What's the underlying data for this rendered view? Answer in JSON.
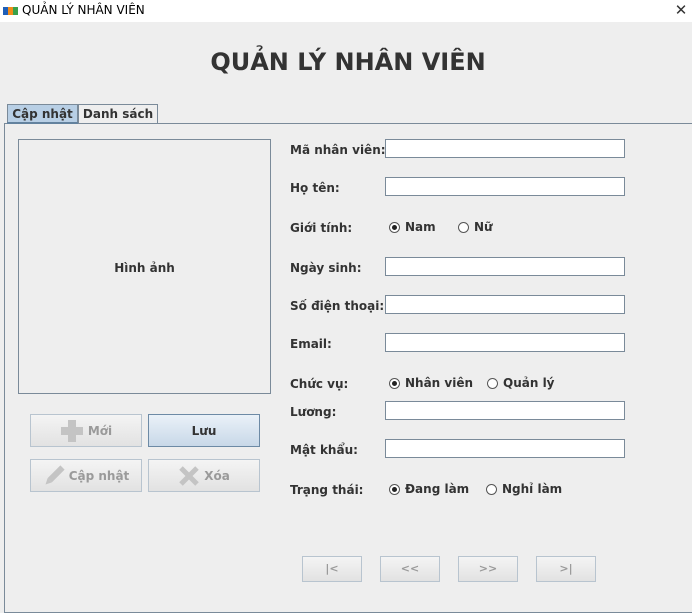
{
  "window": {
    "title": "QUẢN LÝ NHÂN VIÊN",
    "close_glyph": "✕"
  },
  "page": {
    "title": "QUẢN LÝ NHÂN VIÊN"
  },
  "tabs": [
    {
      "label": "Cập nhật",
      "active": true
    },
    {
      "label": "Danh sách",
      "active": false
    }
  ],
  "photo": {
    "label": "Hình ảnh"
  },
  "buttons": {
    "new": "Mới",
    "save": "Lưu",
    "update": "Cập nhật",
    "delete": "Xóa"
  },
  "form": {
    "ma_nv": {
      "label": "Mã nhân viên:",
      "value": ""
    },
    "ho_ten": {
      "label": "Họ tên:",
      "value": ""
    },
    "gioi_tinh": {
      "label": "Giới tính:",
      "options": [
        "Nam",
        "Nữ"
      ],
      "selected": "Nam"
    },
    "ngay_sinh": {
      "label": "Ngày sinh:",
      "value": ""
    },
    "sdt": {
      "label": "Số điện thoại:",
      "value": ""
    },
    "email": {
      "label": "Email:",
      "value": ""
    },
    "chuc_vu": {
      "label": "Chức vụ:",
      "options": [
        "Nhân viên",
        "Quản lý"
      ],
      "selected": "Nhân viên"
    },
    "luong": {
      "label": "Lương:",
      "value": ""
    },
    "mat_khau": {
      "label": "Mật khẩu:",
      "value": ""
    },
    "trang_thai": {
      "label": "Trạng thái:",
      "options": [
        "Đang làm",
        "Nghỉ làm"
      ],
      "selected": "Đang làm"
    }
  },
  "navigation": {
    "first": "|<",
    "prev": "<<",
    "next": ">>",
    "last": ">|"
  },
  "colors": {
    "tab_active": "#b8cfe5",
    "border": "#7a8a99",
    "background": "#eeeeee"
  },
  "icons": [
    "app-logo-icon",
    "close-icon",
    "plus-icon",
    "pencil-icon",
    "x-icon"
  ]
}
